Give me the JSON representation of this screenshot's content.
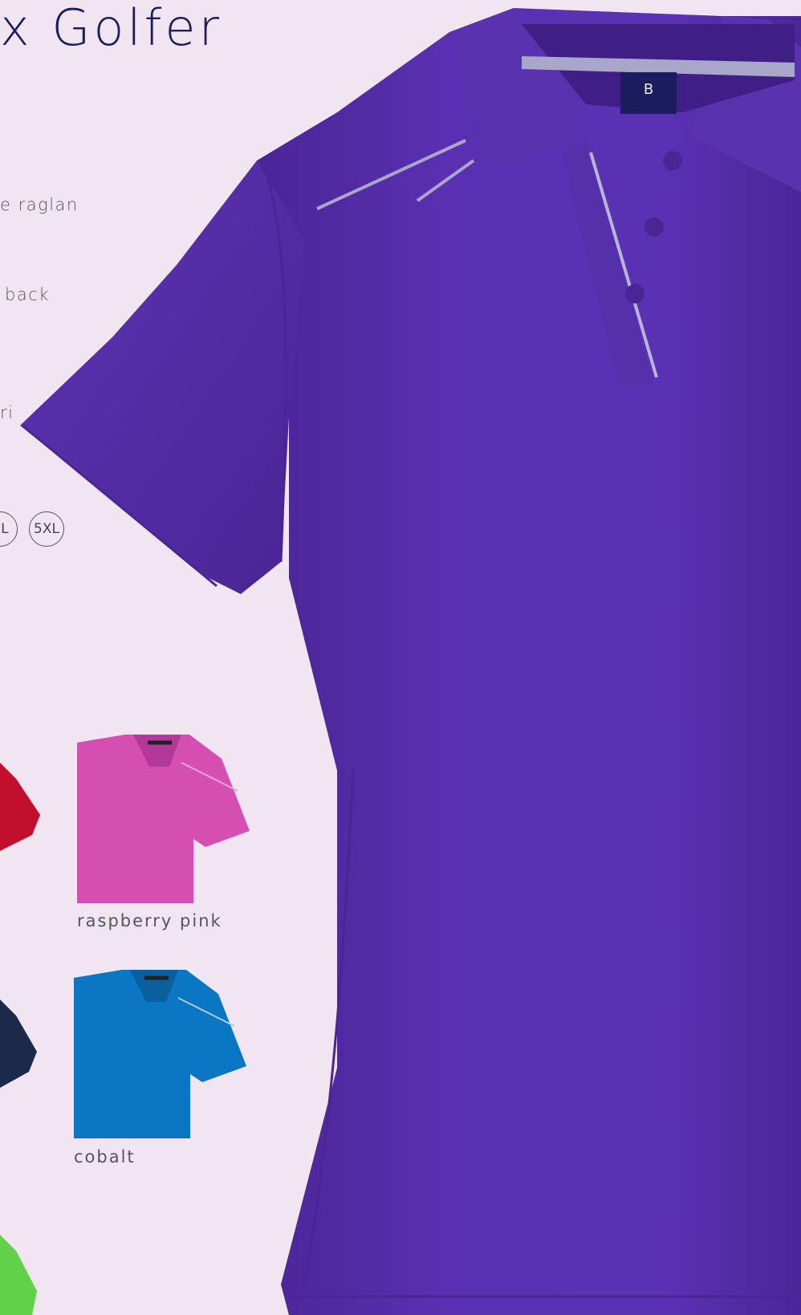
{
  "product": {
    "title_fragment": "x Golfer"
  },
  "features": [
    "e raglan",
    "back",
    "ri"
  ],
  "sizes": {
    "partial": "XL",
    "last": "5XL"
  },
  "swatches": [
    {
      "name": "raspberry pink",
      "color": "#d54fb3"
    },
    {
      "name": "cobalt",
      "color": "#0b77c4"
    }
  ],
  "cut_off_swatches": [
    {
      "color": "#c0102e"
    },
    {
      "color": "#1b2a4a"
    },
    {
      "color": "#62d14a"
    }
  ],
  "hero": {
    "color": "#5a2fb0",
    "collar_logo": "B"
  },
  "colors": {
    "background": "#f1e5f1",
    "title": "#1c1d5e",
    "text": "#55555f"
  }
}
